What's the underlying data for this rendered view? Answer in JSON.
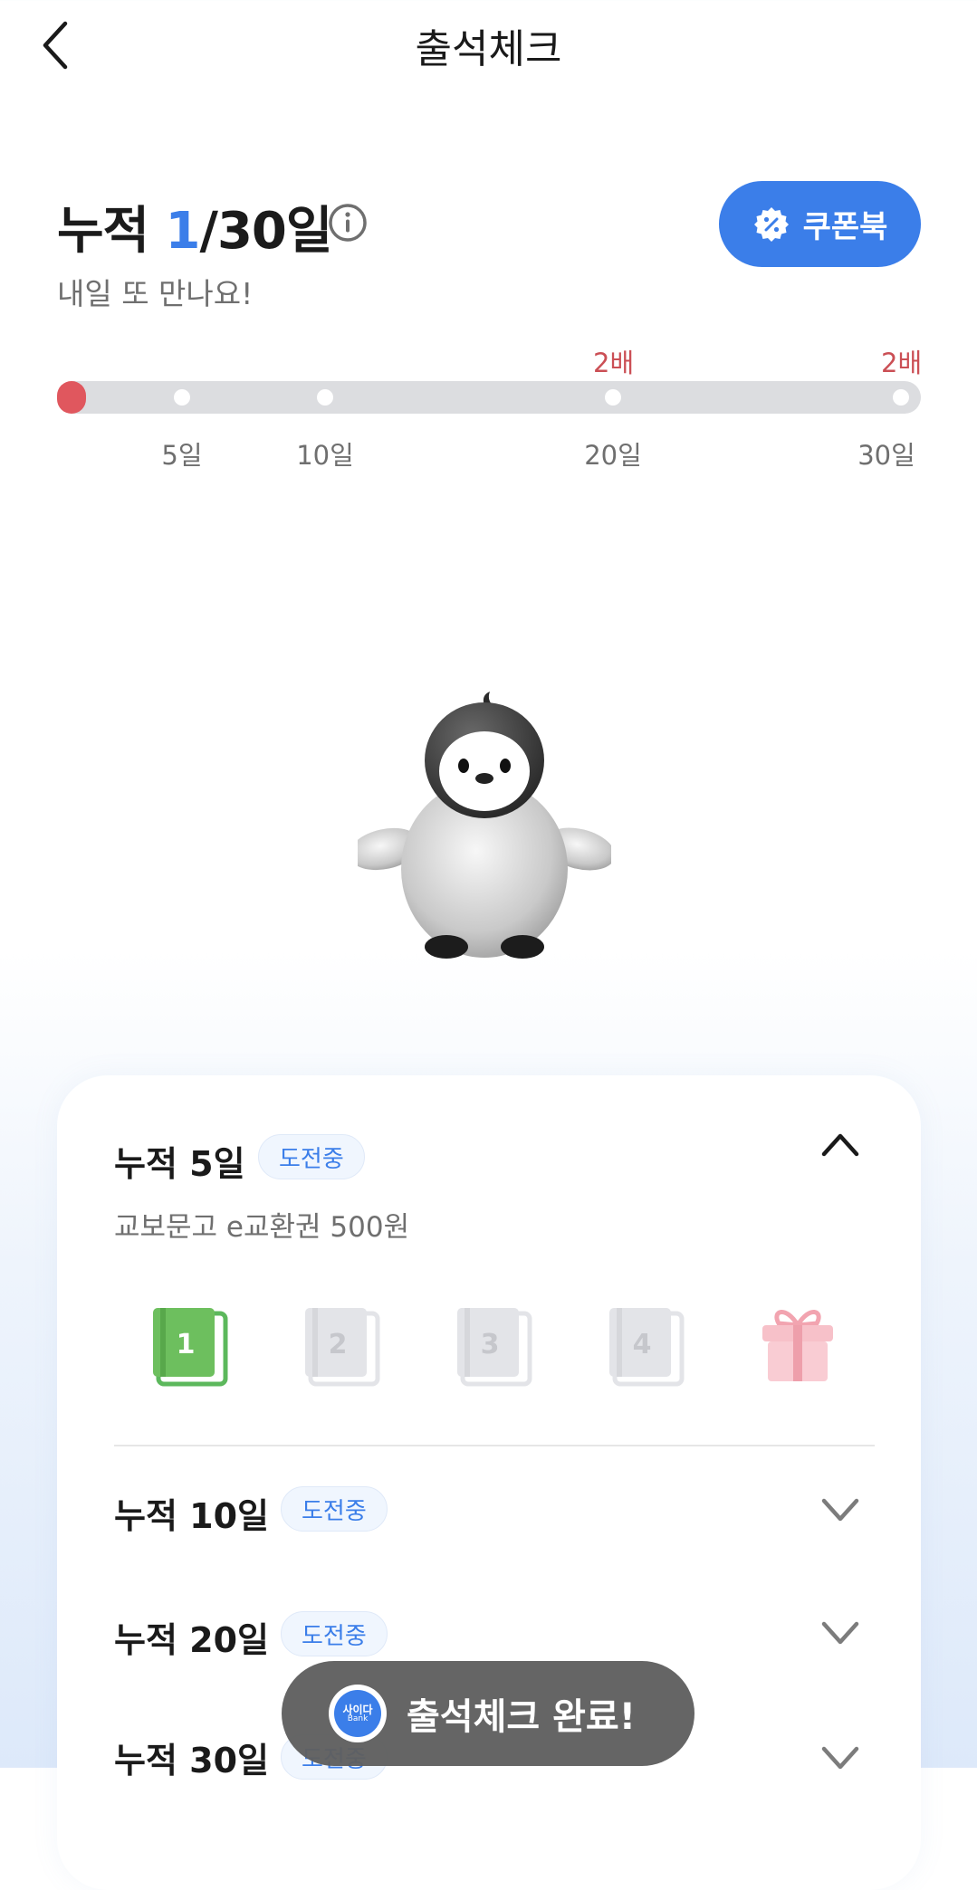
{
  "header": {
    "title": "출석체크"
  },
  "summary": {
    "label": "누적",
    "current": "1",
    "total": "/30일",
    "subtitle": "내일 또 만나요!",
    "coupon_label": "쿠폰북"
  },
  "progress": {
    "current_day": 1,
    "max_day": 30,
    "ticks": [
      "5일",
      "10일",
      "20일",
      "30일"
    ],
    "multipliers": [
      "2배",
      "2배"
    ]
  },
  "missions": [
    {
      "title": "누적 5일",
      "badge": "도전중",
      "reward": "교보문고 e교환권 500원",
      "expanded": true,
      "steps": [
        "1",
        "2",
        "3",
        "4"
      ]
    },
    {
      "title": "누적 10일",
      "badge": "도전중"
    },
    {
      "title": "누적 20일",
      "badge": "도전중"
    },
    {
      "title": "누적 30일",
      "badge": "도전중"
    }
  ],
  "toast": {
    "icon_text_top": "사이다",
    "icon_text_bottom": "Bank",
    "text": "출석체크 완료!"
  },
  "colors": {
    "accent": "#3b7ee9",
    "current": "#e0575e",
    "multiplier": "#cb4f55",
    "done_book": "#5cb85c"
  }
}
